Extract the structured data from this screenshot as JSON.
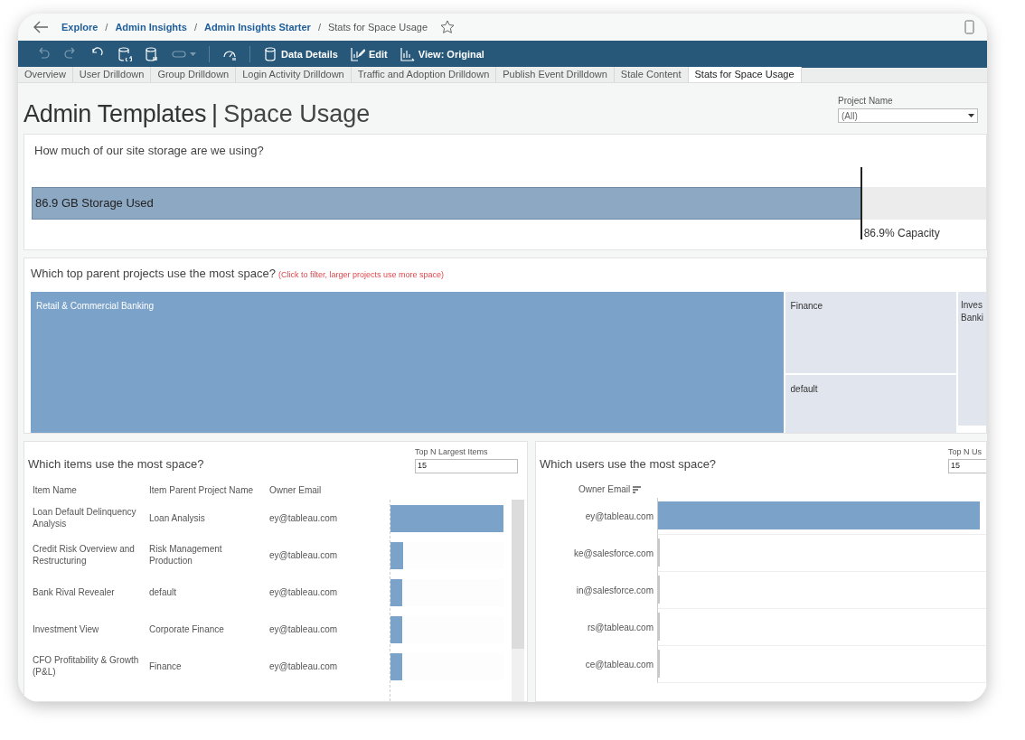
{
  "breadcrumb": {
    "separator": "/",
    "items": [
      {
        "label": "Explore",
        "link": true
      },
      {
        "label": "Admin Insights",
        "link": true
      },
      {
        "label": "Admin Insights Starter",
        "link": true
      },
      {
        "label": "Stats for Space Usage",
        "link": false
      }
    ],
    "favorite": false
  },
  "toolbar": [
    {
      "kind": "undo",
      "disabled": true
    },
    {
      "kind": "redo",
      "disabled": true
    },
    {
      "kind": "revert",
      "disabled": false
    },
    {
      "kind": "refresh",
      "disabled": false
    },
    {
      "kind": "pause",
      "disabled": false
    },
    {
      "kind": "toggle",
      "disabled": true
    },
    {
      "kind": "metrics",
      "disabled": false
    },
    {
      "kind": "data",
      "label": "Data Details",
      "disabled": false
    },
    {
      "kind": "edit",
      "label": "Edit",
      "disabled": false
    },
    {
      "kind": "view",
      "label": "View: Original",
      "disabled": false
    }
  ],
  "tabs": [
    {
      "label": "Overview",
      "selected": false
    },
    {
      "label": "User Drilldown",
      "selected": false
    },
    {
      "label": "Group Drilldown",
      "selected": false
    },
    {
      "label": "Login Activity Drilldown",
      "selected": false
    },
    {
      "label": "Traffic and Adoption Drilldown",
      "selected": false
    },
    {
      "label": "Publish Event Drilldown",
      "selected": false
    },
    {
      "label": "Stale Content",
      "selected": false
    },
    {
      "label": "Stats for Space Usage",
      "selected": true
    }
  ],
  "dashboard": {
    "title_bold": "Admin Templates",
    "divider": "|",
    "title_light": "Space Usage",
    "filter": {
      "label": "Project Name",
      "value": "(All)"
    }
  },
  "storage": {
    "question": "How much of our site storage are we using?",
    "bar_label": "86.9 GB Storage Used",
    "level": 0.869,
    "capacity": "86.9% Capacity"
  },
  "projects": {
    "question": "Which top parent projects use the most space?",
    "hint": "(Click to filter, larger projects use more space)",
    "tiles": [
      {
        "name": "Retail & Commercial Banking",
        "color": "#7ba2c8"
      },
      {
        "name": "Finance",
        "color": "#e1e6ee"
      },
      {
        "name": "default",
        "color": "#e1e6ee"
      },
      {
        "name": "Inves Banki",
        "color": "#e1e6ee"
      }
    ]
  },
  "items": {
    "question": "Which items use the most space?",
    "top_n_label": "Top N Largest Items",
    "top_n_value": "15",
    "columns": [
      "Item Name",
      "Item Parent Project Name",
      "Owner Email"
    ],
    "rows": [
      {
        "name": "Loan Default Delinquency Analysis",
        "project": "Loan Analysis",
        "email": "ey@tableau.com",
        "level": 1.0
      },
      {
        "name": "Credit Risk Overview and Restructuring",
        "project": "Risk Management Production",
        "email": "ey@tableau.com",
        "level": 0.11
      },
      {
        "name": "Bank Rival Revealer",
        "project": "default",
        "email": "ey@tableau.com",
        "level": 0.1
      },
      {
        "name": "Investment View",
        "project": "Corporate Finance",
        "email": "ey@tableau.com",
        "level": 0.1
      },
      {
        "name": "CFO Profitability & Growth (P&L)",
        "project": "Finance",
        "email": "ey@tableau.com",
        "level": 0.1
      }
    ]
  },
  "users": {
    "question": "Which users use the most space?",
    "top_n_label": "Top N Us",
    "top_n_value": "15",
    "column": "Owner Email",
    "rows": [
      {
        "email": "ey@tableau.com",
        "level": 0.98
      },
      {
        "email": "ke@salesforce.com",
        "level": 0.006
      },
      {
        "email": "in@salesforce.com",
        "level": 0.004
      },
      {
        "email": "rs@tableau.com",
        "level": 0.004
      },
      {
        "email": "ce@tableau.com",
        "level": 0.004
      }
    ]
  }
}
